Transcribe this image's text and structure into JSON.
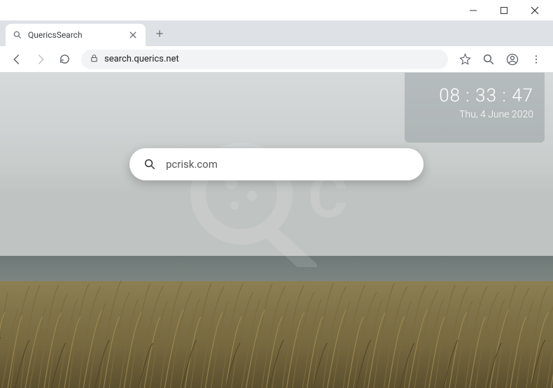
{
  "window": {
    "tab_title": "QuericsSearch"
  },
  "toolbar": {
    "url": "search.querics.net"
  },
  "page": {
    "clock": {
      "time": "08 : 33 : 47",
      "date": "Thu, 4 June 2020"
    },
    "search": {
      "value": "pcrisk.com",
      "placeholder": ""
    }
  }
}
